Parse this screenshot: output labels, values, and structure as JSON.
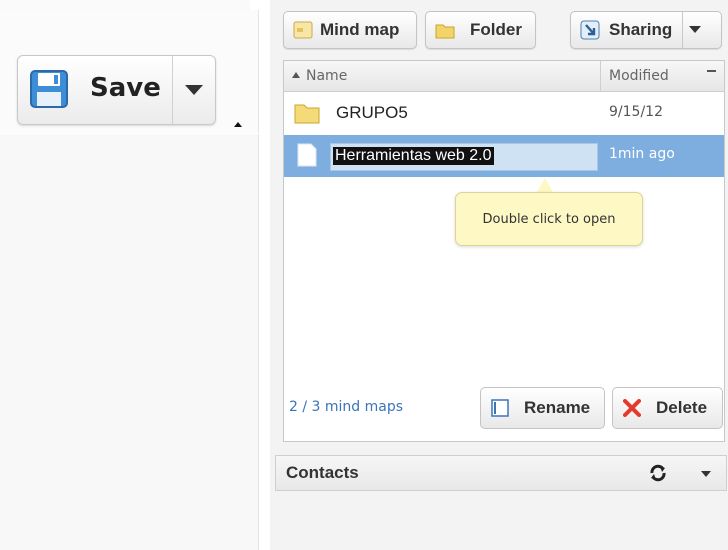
{
  "toolbar": {
    "save_label": "Save"
  },
  "actions": {
    "mind_map_label": "Mind map",
    "folder_label": "Folder",
    "sharing_label": "Sharing"
  },
  "file_list": {
    "columns": {
      "name": "Name",
      "modified": "Modified"
    },
    "rows": [
      {
        "name": "GRUPO5",
        "modified": "9/15/12",
        "type": "folder"
      },
      {
        "name": "Herramientas web 2.0",
        "modified": "1min ago",
        "type": "mind-map",
        "selected": true,
        "editing": true
      }
    ],
    "tooltip": "Double click to open",
    "count_text": "2 / 3 mind maps",
    "rename_label": "Rename",
    "delete_label": "Delete"
  },
  "contacts": {
    "label": "Contacts"
  },
  "colors": {
    "selection": "#7eaedf",
    "tooltip_bg": "#fdf8c4",
    "link": "#3a75b8",
    "delete_icon": "#e23b2e"
  }
}
